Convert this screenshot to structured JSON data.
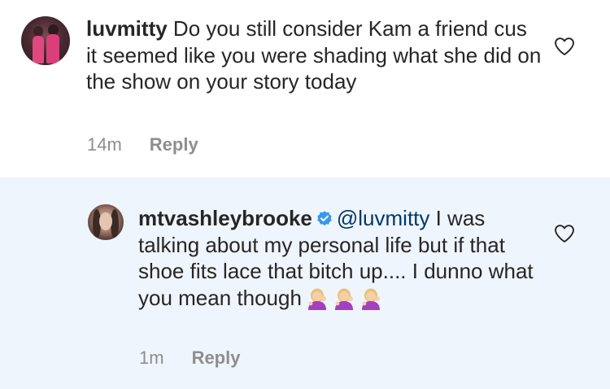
{
  "comment": {
    "username": "luvmitty",
    "text": " Do you still consider Kam a friend cus it seemed like you were shading what she did on the show on your story today",
    "time": "14m",
    "reply_label": "Reply"
  },
  "reply": {
    "username": "mtvashleybrooke",
    "mention": "@luvmitty",
    "text": " I was talking about my personal life but if that shoe fits lace that bitch up.... I dunno what you mean though",
    "emoji": [
      "woman-tipping-hand-emoji",
      "woman-tipping-hand-emoji",
      "woman-tipping-hand-emoji"
    ],
    "time": "1m",
    "reply_label": "Reply"
  },
  "colors": {
    "reply_background": "#eff5fc",
    "mention": "#00376b",
    "verified_badge": "#3897f0",
    "meta_text": "#8e8e8e"
  },
  "icons": {
    "like": "heart-icon",
    "verified": "verified-badge-icon"
  }
}
